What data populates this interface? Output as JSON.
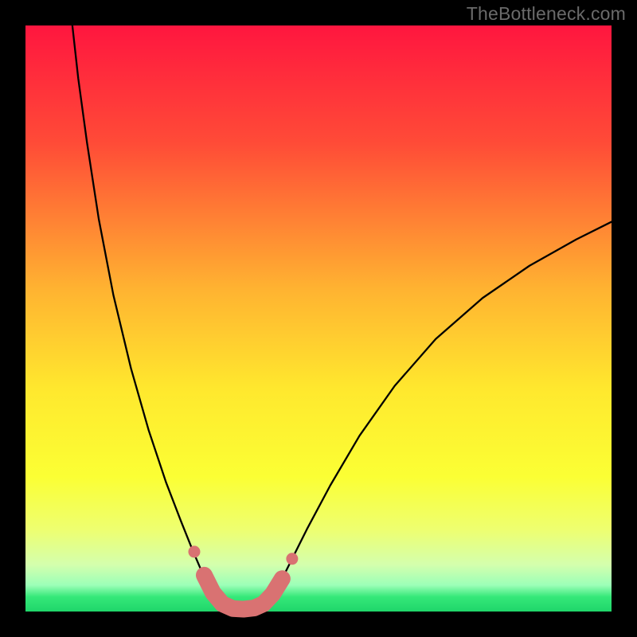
{
  "watermark": "TheBottleneck.com",
  "chart_data": {
    "type": "line",
    "title": "",
    "xlabel": "",
    "ylabel": "",
    "xlim": [
      0,
      100
    ],
    "ylim": [
      0,
      100
    ],
    "gradient_stops": [
      {
        "offset": 0,
        "color": "#ff163f"
      },
      {
        "offset": 0.2,
        "color": "#ff4b37"
      },
      {
        "offset": 0.45,
        "color": "#ffb331"
      },
      {
        "offset": 0.62,
        "color": "#ffe82e"
      },
      {
        "offset": 0.77,
        "color": "#fbff34"
      },
      {
        "offset": 0.86,
        "color": "#eeff70"
      },
      {
        "offset": 0.92,
        "color": "#d4ffad"
      },
      {
        "offset": 0.955,
        "color": "#9cffb8"
      },
      {
        "offset": 0.975,
        "color": "#35e879"
      },
      {
        "offset": 1.0,
        "color": "#1fd66a"
      }
    ],
    "series": [
      {
        "name": "curve",
        "description": "V-shaped bottleneck curve",
        "points": [
          {
            "x": 8.0,
            "y": 100.0
          },
          {
            "x": 9.0,
            "y": 91.0
          },
          {
            "x": 10.5,
            "y": 80.0
          },
          {
            "x": 12.5,
            "y": 67.0
          },
          {
            "x": 15.0,
            "y": 54.0
          },
          {
            "x": 18.0,
            "y": 41.5
          },
          {
            "x": 21.0,
            "y": 31.0
          },
          {
            "x": 24.0,
            "y": 22.0
          },
          {
            "x": 26.5,
            "y": 15.5
          },
          {
            "x": 28.5,
            "y": 10.5
          },
          {
            "x": 30.0,
            "y": 7.0
          },
          {
            "x": 31.5,
            "y": 4.0
          },
          {
            "x": 33.0,
            "y": 1.8
          },
          {
            "x": 34.5,
            "y": 0.6
          },
          {
            "x": 36.0,
            "y": 0.2
          },
          {
            "x": 38.0,
            "y": 0.15
          },
          {
            "x": 40.0,
            "y": 0.6
          },
          {
            "x": 41.5,
            "y": 1.8
          },
          {
            "x": 43.0,
            "y": 4.0
          },
          {
            "x": 45.0,
            "y": 8.0
          },
          {
            "x": 48.0,
            "y": 14.0
          },
          {
            "x": 52.0,
            "y": 21.5
          },
          {
            "x": 57.0,
            "y": 30.0
          },
          {
            "x": 63.0,
            "y": 38.5
          },
          {
            "x": 70.0,
            "y": 46.5
          },
          {
            "x": 78.0,
            "y": 53.5
          },
          {
            "x": 86.0,
            "y": 59.0
          },
          {
            "x": 94.0,
            "y": 63.5
          },
          {
            "x": 100.0,
            "y": 66.5
          }
        ]
      },
      {
        "name": "marker-band",
        "description": "Thick pink/coral band near the minimum",
        "color": "#d97272",
        "points": [
          {
            "x": 30.5,
            "y": 6.2
          },
          {
            "x": 32.0,
            "y": 3.2
          },
          {
            "x": 33.6,
            "y": 1.3
          },
          {
            "x": 35.4,
            "y": 0.5
          },
          {
            "x": 37.2,
            "y": 0.4
          },
          {
            "x": 39.0,
            "y": 0.6
          },
          {
            "x": 40.6,
            "y": 1.3
          },
          {
            "x": 42.2,
            "y": 3.0
          },
          {
            "x": 43.8,
            "y": 5.6
          }
        ]
      },
      {
        "name": "marker-dots",
        "description": "Two isolated coral dots just outside the band",
        "color": "#d97272",
        "points": [
          {
            "x": 28.8,
            "y": 10.2
          },
          {
            "x": 45.5,
            "y": 9.0
          }
        ]
      }
    ]
  }
}
